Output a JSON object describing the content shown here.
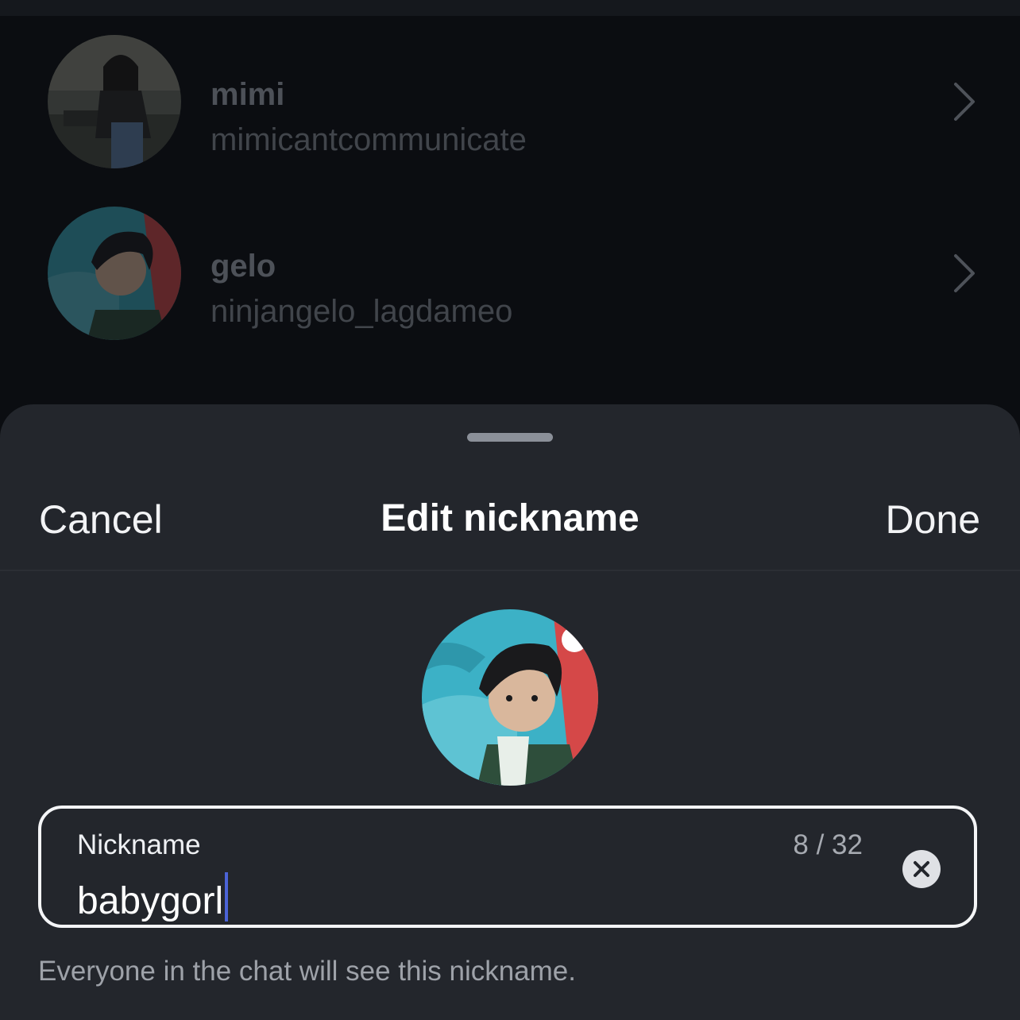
{
  "contacts": [
    {
      "name": "mimi",
      "handle": "mimicantcommunicate",
      "avatar_icon": "person-photo-avatar",
      "chevron_icon": "chevron-right-icon"
    },
    {
      "name": "gelo",
      "handle": "ninjangelo_lagdameo",
      "avatar_icon": "person-photo-avatar",
      "chevron_icon": "chevron-right-icon"
    }
  ],
  "sheet": {
    "cancel_label": "Cancel",
    "title": "Edit nickname",
    "done_label": "Done",
    "avatar_icon": "person-photo-avatar",
    "field": {
      "label": "Nickname",
      "counter": "8 / 32",
      "value": "babygorl",
      "clear_icon": "clear-x-icon"
    },
    "hint": "Everyone in the chat will see this nickname."
  },
  "colors": {
    "background": "#0b0d11",
    "sheet": "#23262c",
    "caret": "#4b63d6",
    "text_primary": "#ffffff"
  }
}
